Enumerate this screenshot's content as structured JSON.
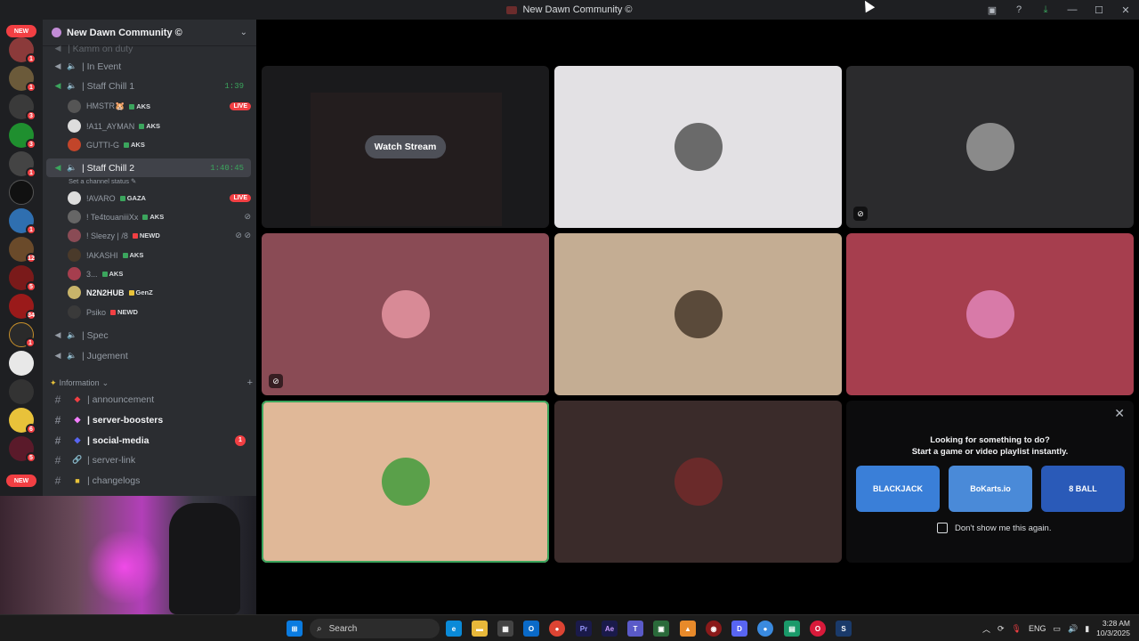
{
  "window": {
    "title": "New Dawn Community ©"
  },
  "server_rail": {
    "new_top": "NEW",
    "new_bottom": "NEW",
    "badges": [
      "1",
      "1",
      "3",
      "3",
      "1",
      "1",
      "1",
      "12",
      "5",
      "34",
      "1",
      "6",
      "5"
    ]
  },
  "sidebar": {
    "server_name": "New Dawn Community ©",
    "partial_channel": "| Kamm on duty",
    "channels": [
      {
        "label": "| In Event"
      },
      {
        "label": "| Staff Chill 1",
        "time": "1:39"
      },
      {
        "label": "| Staff Chill 2",
        "time": "1:40:45",
        "status": "Set a channel status"
      },
      {
        "label": "| Spec"
      },
      {
        "label": "| Jugement"
      }
    ],
    "chill1_users": [
      {
        "name": "HMSTR🐹",
        "tag": "AKS",
        "live": "LIVE"
      },
      {
        "name": "!A11_AYMAN",
        "tag": "AKS"
      },
      {
        "name": "GUTTI-G",
        "tag": "AKS"
      }
    ],
    "chill2_users": [
      {
        "name": "!AVARO",
        "tag": "GAZA",
        "live": "LIVE"
      },
      {
        "name": "! Te4touaniiiXx",
        "tag": "AKS"
      },
      {
        "name": "! Sleezy | /8",
        "tag": "NEWD"
      },
      {
        "name": "!AKASHI",
        "tag": "AKS"
      },
      {
        "name": "3...",
        "tag": "AKS"
      },
      {
        "name": "N2N2HUB",
        "tag": "GenZ"
      },
      {
        "name": "Psiko",
        "tag": "NEWD"
      }
    ],
    "category": "Information",
    "text_channels": [
      {
        "label": "| announcement"
      },
      {
        "label": "| server-boosters"
      },
      {
        "label": "| social-media",
        "mentions": "1"
      },
      {
        "label": "| server-link"
      },
      {
        "label": "| changelogs"
      }
    ]
  },
  "stage": {
    "watch_stream": "Watch Stream",
    "activity": {
      "line1": "Looking for something to do?",
      "line2": "Start a game or video playlist instantly.",
      "games": [
        "BLACKJACK",
        "BoKarts.io",
        "8 BALL"
      ],
      "checkbox_label": "Don't show me this again."
    },
    "tile_colors": [
      "#1a1a1c",
      "#e3e1e4",
      "#2b2b2d",
      "#8a4b55",
      "#c4ad93",
      "#a63e4e",
      "#e0b898",
      "#3a2b2a"
    ]
  },
  "taskbar": {
    "search_placeholder": "Search",
    "lang": "ENG",
    "time": "3:28 AM",
    "date": "10/3/2025"
  }
}
